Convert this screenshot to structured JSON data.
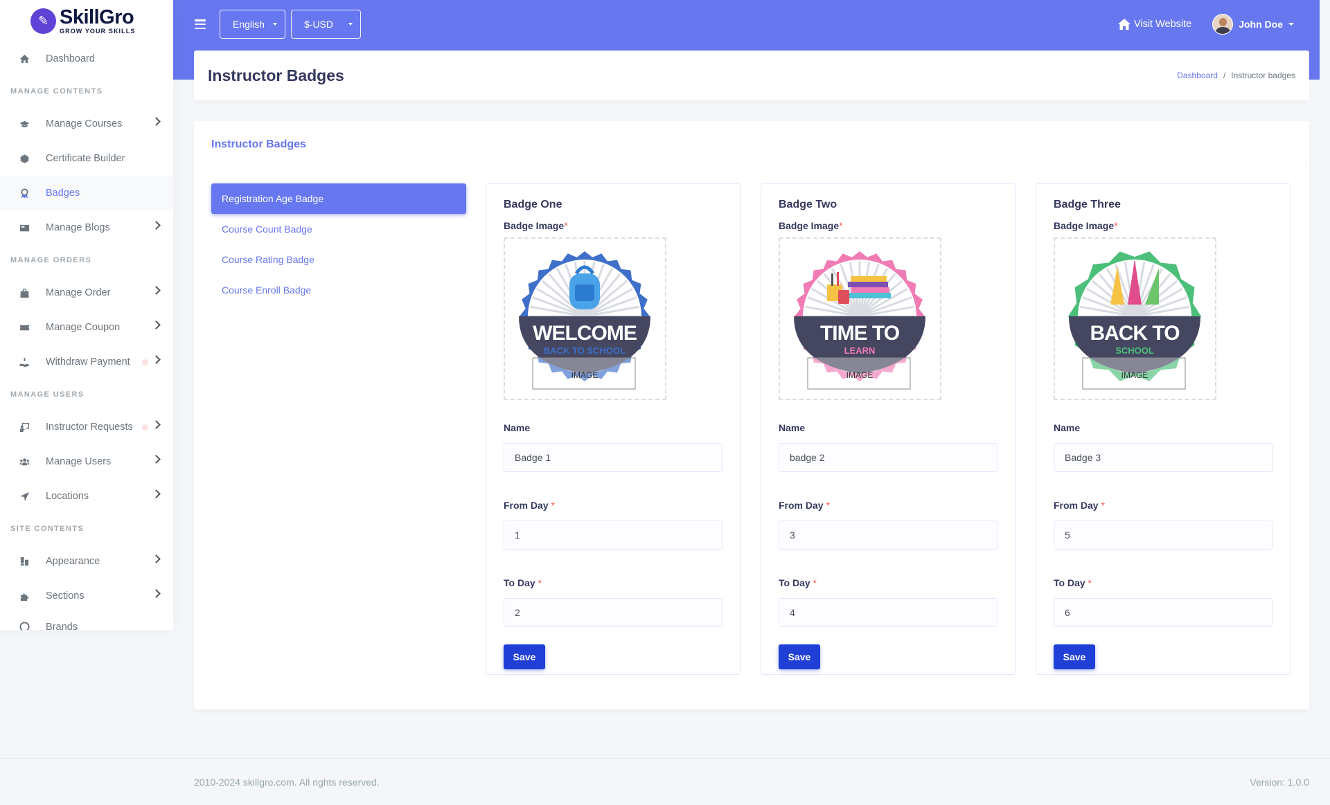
{
  "brand": {
    "name": "SkillGro",
    "tagline": "GROW YOUR SKILLS"
  },
  "sidebar": {
    "items": [
      {
        "type": "item",
        "label": "Dashboard",
        "icon": "home-icon",
        "name": "sidebar-item-dashboard",
        "chevron": false
      },
      {
        "type": "header",
        "label": "MANAGE CONTENTS"
      },
      {
        "type": "item",
        "label": "Manage Courses",
        "icon": "graduation-cap-icon",
        "name": "sidebar-item-manage-courses",
        "chevron": true
      },
      {
        "type": "item",
        "label": "Certificate Builder",
        "icon": "certificate-icon",
        "name": "sidebar-item-certificate-builder",
        "chevron": false
      },
      {
        "type": "item",
        "label": "Badges",
        "icon": "award-icon",
        "name": "sidebar-item-badges",
        "chevron": false,
        "active": true
      },
      {
        "type": "item",
        "label": "Manage Blogs",
        "icon": "newspaper-icon",
        "name": "sidebar-item-manage-blogs",
        "chevron": true
      },
      {
        "type": "header",
        "label": "MANAGE ORDERS"
      },
      {
        "type": "item",
        "label": "Manage Order",
        "icon": "shopping-bag-icon",
        "name": "sidebar-item-manage-order",
        "chevron": true
      },
      {
        "type": "item",
        "label": "Manage Coupon",
        "icon": "coupon-icon",
        "name": "sidebar-item-manage-coupon",
        "chevron": true
      },
      {
        "type": "item",
        "label": "Withdraw Payment",
        "icon": "hand-holding-dollar-icon",
        "name": "sidebar-item-withdraw-payment",
        "chevron": true,
        "dot": true
      },
      {
        "type": "header",
        "label": "MANAGE USERS"
      },
      {
        "type": "item",
        "label": "Instructor Requests",
        "icon": "chalkboard-user-icon",
        "name": "sidebar-item-instructor-requests",
        "chevron": true,
        "dot": true
      },
      {
        "type": "item",
        "label": "Manage Users",
        "icon": "users-icon",
        "name": "sidebar-item-manage-users",
        "chevron": true
      },
      {
        "type": "item",
        "label": "Locations",
        "icon": "location-arrow-icon",
        "name": "sidebar-item-locations",
        "chevron": true
      },
      {
        "type": "header",
        "label": "SITE CONTENTS"
      },
      {
        "type": "item",
        "label": "Appearance",
        "icon": "paint-brush-icon",
        "name": "sidebar-item-appearance",
        "chevron": true
      },
      {
        "type": "item",
        "label": "Sections",
        "icon": "puzzle-piece-icon",
        "name": "sidebar-item-sections",
        "chevron": true
      },
      {
        "type": "item",
        "label": "Brands",
        "icon": "copyright-icon",
        "name": "sidebar-item-brands",
        "chevron": false,
        "cut": true
      }
    ]
  },
  "navbar": {
    "language": "English",
    "currency": "$-USD",
    "visit_website": "Visit Website",
    "user_name": "John Doe"
  },
  "page": {
    "title": "Instructor Badges",
    "breadcrumb": {
      "home": "Dashboard",
      "current": "Instructor badges"
    }
  },
  "card": {
    "title": "Instructor Badges",
    "tabs": [
      {
        "label": "Registration Age Badge",
        "active": true
      },
      {
        "label": "Course Count Badge",
        "active": false
      },
      {
        "label": "Course Rating Badge",
        "active": false
      },
      {
        "label": "Course Enroll Badge",
        "active": false
      }
    ],
    "badges": [
      {
        "title": "Badge One",
        "image_label": "Badge Image",
        "image": {
          "icon": "welcome-back-to-school-badge-icon",
          "color": "#3e6fc9",
          "line1": "WELCOME",
          "line2": "BACK TO SCHOOL",
          "overlay": "IMAGE"
        },
        "name_label": "Name",
        "name_value": "Badge 1",
        "from_label": "From Day",
        "from_value": "1",
        "to_label": "To Day",
        "to_value": "2",
        "save": "Save"
      },
      {
        "title": "Badge Two",
        "image_label": "Badge Image",
        "image": {
          "icon": "time-to-learn-badge-icon",
          "color": "#f07bb5",
          "line1": "TIME TO",
          "line2": "LEARN",
          "overlay": "IMAGE"
        },
        "name_label": "Name",
        "name_value": "badge 2",
        "from_label": "From Day",
        "from_value": "3",
        "to_label": "To Day",
        "to_value": "4",
        "save": "Save"
      },
      {
        "title": "Badge Three",
        "image_label": "Badge Image",
        "image": {
          "icon": "back-to-school-badge-icon",
          "color": "#4cbf7a",
          "line1": "BACK TO",
          "line2": "SCHOOL",
          "overlay": "IMAGE"
        },
        "name_label": "Name",
        "name_value": "Badge 3",
        "from_label": "From Day",
        "from_value": "5",
        "to_label": "To Day",
        "to_value": "6",
        "save": "Save"
      }
    ]
  },
  "footer": {
    "copyright": "2010-2024 skillgro.com. All rights reserved.",
    "version": "Version: 1.0.0"
  },
  "colors": {
    "primary": "#6777ef",
    "save_button": "#1f3fd6",
    "required": "#fc544b"
  }
}
